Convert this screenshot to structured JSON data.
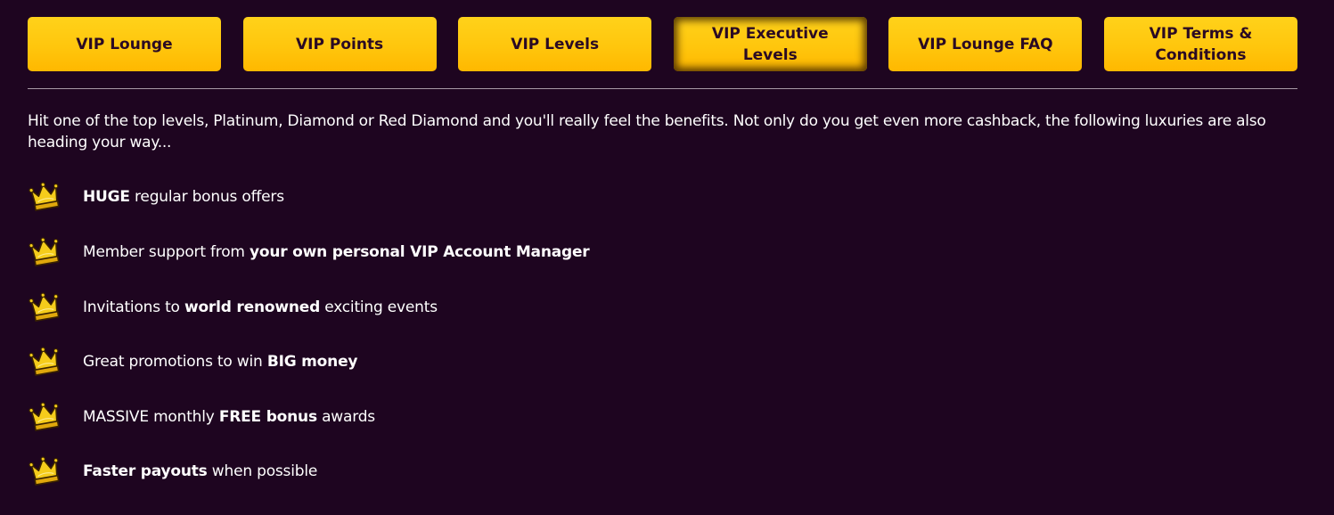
{
  "tabs": [
    {
      "label": "VIP Lounge"
    },
    {
      "label": "VIP Points"
    },
    {
      "label": "VIP Levels"
    },
    {
      "label": "VIP Executive Levels"
    },
    {
      "label": "VIP Lounge FAQ"
    },
    {
      "label": "VIP Terms & Conditions"
    }
  ],
  "active_tab": "VIP Executive Levels",
  "intro": "Hit one of the top levels, Platinum, Diamond or Red Diamond and you'll really feel the benefits. Not only do you get even more cashback, the following luxuries are also heading your way...",
  "benefits": [
    {
      "parts": [
        "",
        "HUGE",
        " regular bonus offers"
      ]
    },
    {
      "parts": [
        "Member support from ",
        "your own personal VIP Account Manager",
        ""
      ]
    },
    {
      "parts": [
        "Invitations to ",
        "world renowned",
        " exciting events"
      ]
    },
    {
      "parts": [
        "Great promotions to win ",
        "BIG money",
        ""
      ]
    },
    {
      "parts": [
        "MASSIVE monthly ",
        "FREE bonus",
        " awards"
      ]
    },
    {
      "parts": [
        "",
        "Faster payouts",
        " when possible"
      ]
    }
  ],
  "colors": {
    "background": "#1e0520",
    "tab_gradient_top": "#ffd21a",
    "tab_gradient_bottom": "#ffb800",
    "tab_text": "#2a0a24",
    "divider": "#a89aa6",
    "text": "#ffffff",
    "crown": "#f5cc1b"
  },
  "icons": {
    "benefit_bullet": "crown-icon"
  }
}
